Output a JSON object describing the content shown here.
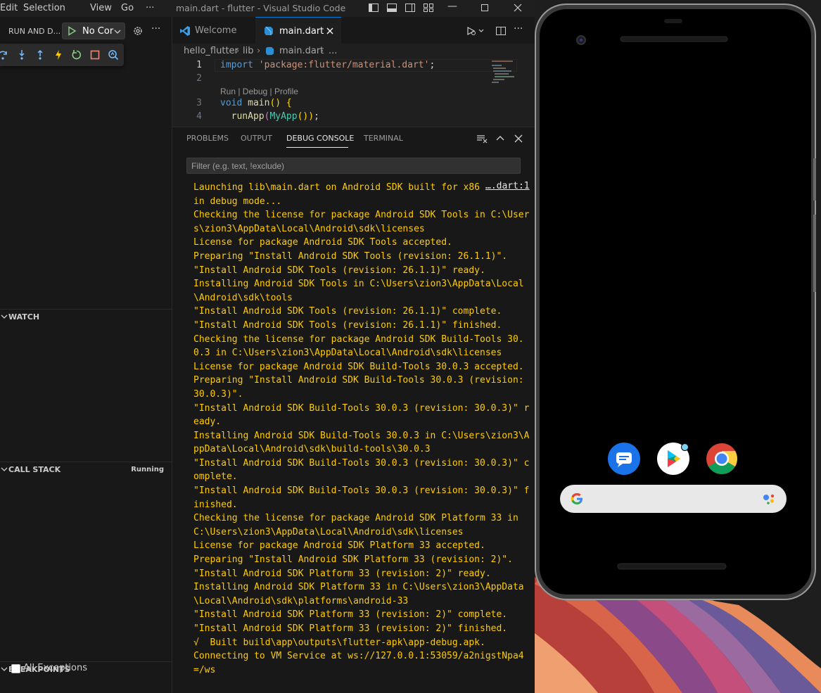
{
  "titlebar": {
    "menus": [
      "Edit",
      "Selection",
      "View",
      "Go",
      "···"
    ],
    "title": "main.dart - flutter - Visual Studio Code"
  },
  "sidebar": {
    "header_label": "RUN AND D...",
    "config_label": "No Cor",
    "sections": {
      "watch": "WATCH",
      "call_stack": "CALL STACK",
      "call_stack_status": "Running",
      "breakpoints": "BREAKPOINTS"
    },
    "all_exceptions_label": "All Exceptions"
  },
  "editor": {
    "tabs": [
      {
        "label": "Welcome"
      },
      {
        "label": "main.dart"
      }
    ],
    "breadcrumb": [
      "hello_flutter",
      "lib",
      "main.dart",
      "..."
    ],
    "code": {
      "line_numbers": [
        "1",
        "2",
        "3",
        "4"
      ],
      "line1_keyword": "import",
      "line1_string": "'package:flutter/material.dart'",
      "line1_semicolon": ";",
      "codelens": "Run | Debug | Profile",
      "line3_keyword": "void",
      "line3_fn": "main",
      "line3_rest": "() {",
      "line4_fn": "runApp",
      "line4_cls": "MyApp",
      "line4_rest": "());"
    }
  },
  "panel": {
    "tabs": [
      "PROBLEMS",
      "OUTPUT",
      "DEBUG CONSOLE",
      "TERMINAL"
    ],
    "filter_placeholder": "Filter (e.g. text, !exclude)",
    "source_link": "….dart:1",
    "console_lines": [
      "Launching lib\\main.dart on Android SDK built for x86",
      "in debug mode...",
      "Checking the license for package Android SDK Tools in C:\\User",
      "s\\zion3\\AppData\\Local\\Android\\sdk\\licenses",
      "License for package Android SDK Tools accepted.",
      "Preparing \"Install Android SDK Tools (revision: 26.1.1)\".",
      "\"Install Android SDK Tools (revision: 26.1.1)\" ready.",
      "Installing Android SDK Tools in C:\\Users\\zion3\\AppData\\Local",
      "\\Android\\sdk\\tools",
      "\"Install Android SDK Tools (revision: 26.1.1)\" complete.",
      "\"Install Android SDK Tools (revision: 26.1.1)\" finished.",
      "Checking the license for package Android SDK Build-Tools 30.",
      "0.3 in C:\\Users\\zion3\\AppData\\Local\\Android\\sdk\\licenses",
      "License for package Android SDK Build-Tools 30.0.3 accepted.",
      "Preparing \"Install Android SDK Build-Tools 30.0.3 (revision:",
      "30.0.3)\".",
      "\"Install Android SDK Build-Tools 30.0.3 (revision: 30.0.3)\" r",
      "eady.",
      "Installing Android SDK Build-Tools 30.0.3 in C:\\Users\\zion3\\A",
      "ppData\\Local\\Android\\sdk\\build-tools\\30.0.3",
      "\"Install Android SDK Build-Tools 30.0.3 (revision: 30.0.3)\" c",
      "omplete.",
      "\"Install Android SDK Build-Tools 30.0.3 (revision: 30.0.3)\" f",
      "inished.",
      "Checking the license for package Android SDK Platform 33 in",
      "C:\\Users\\zion3\\AppData\\Local\\Android\\sdk\\licenses",
      "License for package Android SDK Platform 33 accepted.",
      "Preparing \"Install Android SDK Platform 33 (revision: 2)\".",
      "\"Install Android SDK Platform 33 (revision: 2)\" ready.",
      "Installing Android SDK Platform 33 in C:\\Users\\zion3\\AppData",
      "\\Local\\Android\\sdk\\platforms\\android-33",
      "\"Install Android SDK Platform 33 (revision: 2)\" complete.",
      "\"Install Android SDK Platform 33 (revision: 2)\" finished.",
      "√  Built build\\app\\outputs\\flutter-apk\\app-debug.apk.",
      "Connecting to VM Service at ws://127.0.0.1:53059/a2nigstNpa4",
      "=/ws"
    ]
  },
  "colors": {
    "console_text": "#ffcc00",
    "accent": "#0078d4"
  },
  "icons": {
    "debug_toolbar": [
      "step-over-icon",
      "step-into-icon",
      "step-out-icon",
      "hot-reload-icon",
      "restart-icon",
      "stop-icon",
      "open-devtools-icon"
    ],
    "emulator_apps": [
      "messages-icon",
      "play-store-icon",
      "chrome-icon"
    ]
  }
}
